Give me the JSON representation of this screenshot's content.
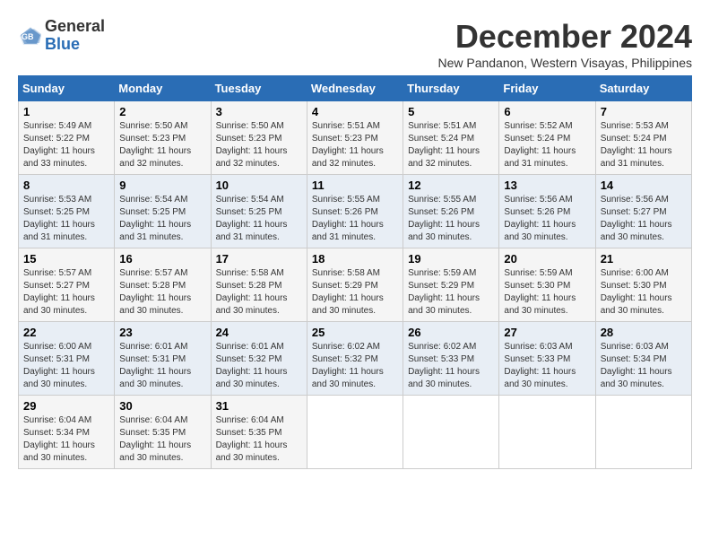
{
  "logo": {
    "line1": "General",
    "line2": "Blue"
  },
  "title": "December 2024",
  "subtitle": "New Pandanon, Western Visayas, Philippines",
  "weekdays": [
    "Sunday",
    "Monday",
    "Tuesday",
    "Wednesday",
    "Thursday",
    "Friday",
    "Saturday"
  ],
  "weeks": [
    [
      {
        "day": "1",
        "info": "Sunrise: 5:49 AM\nSunset: 5:22 PM\nDaylight: 11 hours\nand 33 minutes."
      },
      {
        "day": "2",
        "info": "Sunrise: 5:50 AM\nSunset: 5:23 PM\nDaylight: 11 hours\nand 32 minutes."
      },
      {
        "day": "3",
        "info": "Sunrise: 5:50 AM\nSunset: 5:23 PM\nDaylight: 11 hours\nand 32 minutes."
      },
      {
        "day": "4",
        "info": "Sunrise: 5:51 AM\nSunset: 5:23 PM\nDaylight: 11 hours\nand 32 minutes."
      },
      {
        "day": "5",
        "info": "Sunrise: 5:51 AM\nSunset: 5:24 PM\nDaylight: 11 hours\nand 32 minutes."
      },
      {
        "day": "6",
        "info": "Sunrise: 5:52 AM\nSunset: 5:24 PM\nDaylight: 11 hours\nand 31 minutes."
      },
      {
        "day": "7",
        "info": "Sunrise: 5:53 AM\nSunset: 5:24 PM\nDaylight: 11 hours\nand 31 minutes."
      }
    ],
    [
      {
        "day": "8",
        "info": "Sunrise: 5:53 AM\nSunset: 5:25 PM\nDaylight: 11 hours\nand 31 minutes."
      },
      {
        "day": "9",
        "info": "Sunrise: 5:54 AM\nSunset: 5:25 PM\nDaylight: 11 hours\nand 31 minutes."
      },
      {
        "day": "10",
        "info": "Sunrise: 5:54 AM\nSunset: 5:25 PM\nDaylight: 11 hours\nand 31 minutes."
      },
      {
        "day": "11",
        "info": "Sunrise: 5:55 AM\nSunset: 5:26 PM\nDaylight: 11 hours\nand 31 minutes."
      },
      {
        "day": "12",
        "info": "Sunrise: 5:55 AM\nSunset: 5:26 PM\nDaylight: 11 hours\nand 30 minutes."
      },
      {
        "day": "13",
        "info": "Sunrise: 5:56 AM\nSunset: 5:26 PM\nDaylight: 11 hours\nand 30 minutes."
      },
      {
        "day": "14",
        "info": "Sunrise: 5:56 AM\nSunset: 5:27 PM\nDaylight: 11 hours\nand 30 minutes."
      }
    ],
    [
      {
        "day": "15",
        "info": "Sunrise: 5:57 AM\nSunset: 5:27 PM\nDaylight: 11 hours\nand 30 minutes."
      },
      {
        "day": "16",
        "info": "Sunrise: 5:57 AM\nSunset: 5:28 PM\nDaylight: 11 hours\nand 30 minutes."
      },
      {
        "day": "17",
        "info": "Sunrise: 5:58 AM\nSunset: 5:28 PM\nDaylight: 11 hours\nand 30 minutes."
      },
      {
        "day": "18",
        "info": "Sunrise: 5:58 AM\nSunset: 5:29 PM\nDaylight: 11 hours\nand 30 minutes."
      },
      {
        "day": "19",
        "info": "Sunrise: 5:59 AM\nSunset: 5:29 PM\nDaylight: 11 hours\nand 30 minutes."
      },
      {
        "day": "20",
        "info": "Sunrise: 5:59 AM\nSunset: 5:30 PM\nDaylight: 11 hours\nand 30 minutes."
      },
      {
        "day": "21",
        "info": "Sunrise: 6:00 AM\nSunset: 5:30 PM\nDaylight: 11 hours\nand 30 minutes."
      }
    ],
    [
      {
        "day": "22",
        "info": "Sunrise: 6:00 AM\nSunset: 5:31 PM\nDaylight: 11 hours\nand 30 minutes."
      },
      {
        "day": "23",
        "info": "Sunrise: 6:01 AM\nSunset: 5:31 PM\nDaylight: 11 hours\nand 30 minutes."
      },
      {
        "day": "24",
        "info": "Sunrise: 6:01 AM\nSunset: 5:32 PM\nDaylight: 11 hours\nand 30 minutes."
      },
      {
        "day": "25",
        "info": "Sunrise: 6:02 AM\nSunset: 5:32 PM\nDaylight: 11 hours\nand 30 minutes."
      },
      {
        "day": "26",
        "info": "Sunrise: 6:02 AM\nSunset: 5:33 PM\nDaylight: 11 hours\nand 30 minutes."
      },
      {
        "day": "27",
        "info": "Sunrise: 6:03 AM\nSunset: 5:33 PM\nDaylight: 11 hours\nand 30 minutes."
      },
      {
        "day": "28",
        "info": "Sunrise: 6:03 AM\nSunset: 5:34 PM\nDaylight: 11 hours\nand 30 minutes."
      }
    ],
    [
      {
        "day": "29",
        "info": "Sunrise: 6:04 AM\nSunset: 5:34 PM\nDaylight: 11 hours\nand 30 minutes."
      },
      {
        "day": "30",
        "info": "Sunrise: 6:04 AM\nSunset: 5:35 PM\nDaylight: 11 hours\nand 30 minutes."
      },
      {
        "day": "31",
        "info": "Sunrise: 6:04 AM\nSunset: 5:35 PM\nDaylight: 11 hours\nand 30 minutes."
      },
      null,
      null,
      null,
      null
    ]
  ]
}
